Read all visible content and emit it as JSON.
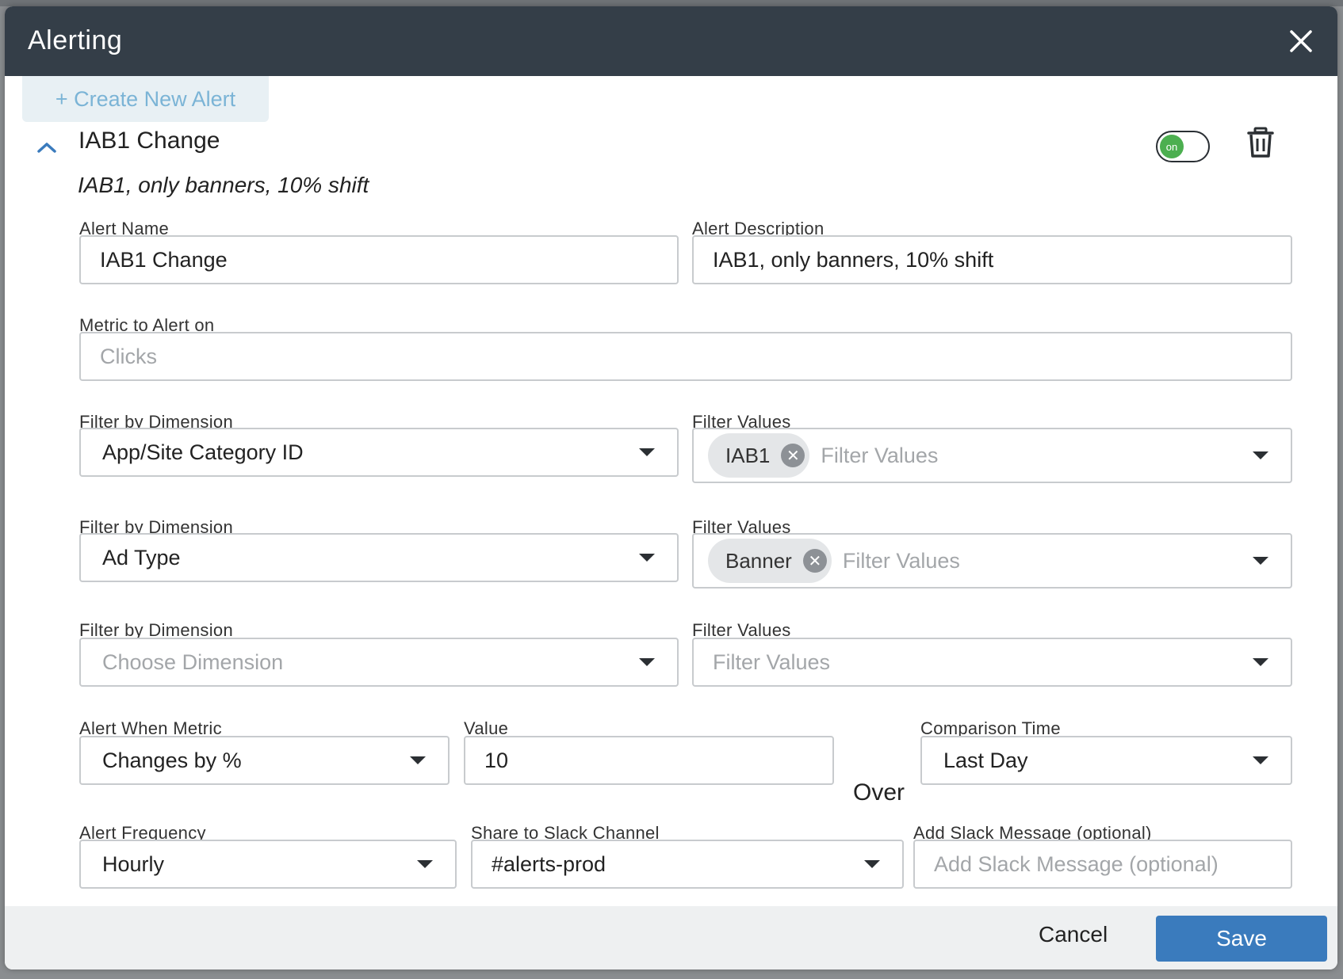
{
  "modal": {
    "title": "Alerting",
    "close_icon": "close-icon"
  },
  "create_button": "+ Create New Alert",
  "alert": {
    "title": "IAB1 Change",
    "subtitle": "IAB1, only banners, 10% shift",
    "toggle_label": "on",
    "enabled": true
  },
  "fields": {
    "alert_name": {
      "label": "Alert Name",
      "value": "IAB1 Change"
    },
    "alert_description": {
      "label": "Alert Description",
      "value": "IAB1, only banners, 10% shift"
    },
    "metric": {
      "label": "Metric to Alert on",
      "placeholder": "Clicks"
    },
    "filters": [
      {
        "dim_label": "Filter by Dimension",
        "dim_value": "App/Site Category ID",
        "values_label": "Filter Values",
        "chips": [
          "IAB1"
        ],
        "values_placeholder": "Filter Values"
      },
      {
        "dim_label": "Filter by Dimension",
        "dim_value": "Ad Type",
        "values_label": "Filter Values",
        "chips": [
          "Banner"
        ],
        "values_placeholder": "Filter Values"
      },
      {
        "dim_label": "Filter by Dimension",
        "dim_placeholder": "Choose Dimension",
        "values_label": "Filter Values",
        "chips": [],
        "values_placeholder": "Filter Values"
      }
    ],
    "alert_when": {
      "label": "Alert When Metric",
      "value": "Changes by %"
    },
    "value": {
      "label": "Value",
      "value": "10"
    },
    "over_label": "Over",
    "comparison_time": {
      "label": "Comparison Time",
      "value": "Last Day"
    },
    "frequency": {
      "label": "Alert Frequency",
      "value": "Hourly"
    },
    "slack_channel": {
      "label": "Share to Slack Channel",
      "value": "#alerts-prod"
    },
    "slack_message": {
      "label": "Add Slack Message (optional)",
      "placeholder": "Add Slack Message (optional)"
    }
  },
  "footer": {
    "cancel_label": "Cancel",
    "save_label": "Save"
  },
  "colors": {
    "header_bg": "#343e48",
    "save_bg": "#3a7bbd",
    "toggle_on": "#4caf50",
    "create_text": "#7bb4d6"
  }
}
